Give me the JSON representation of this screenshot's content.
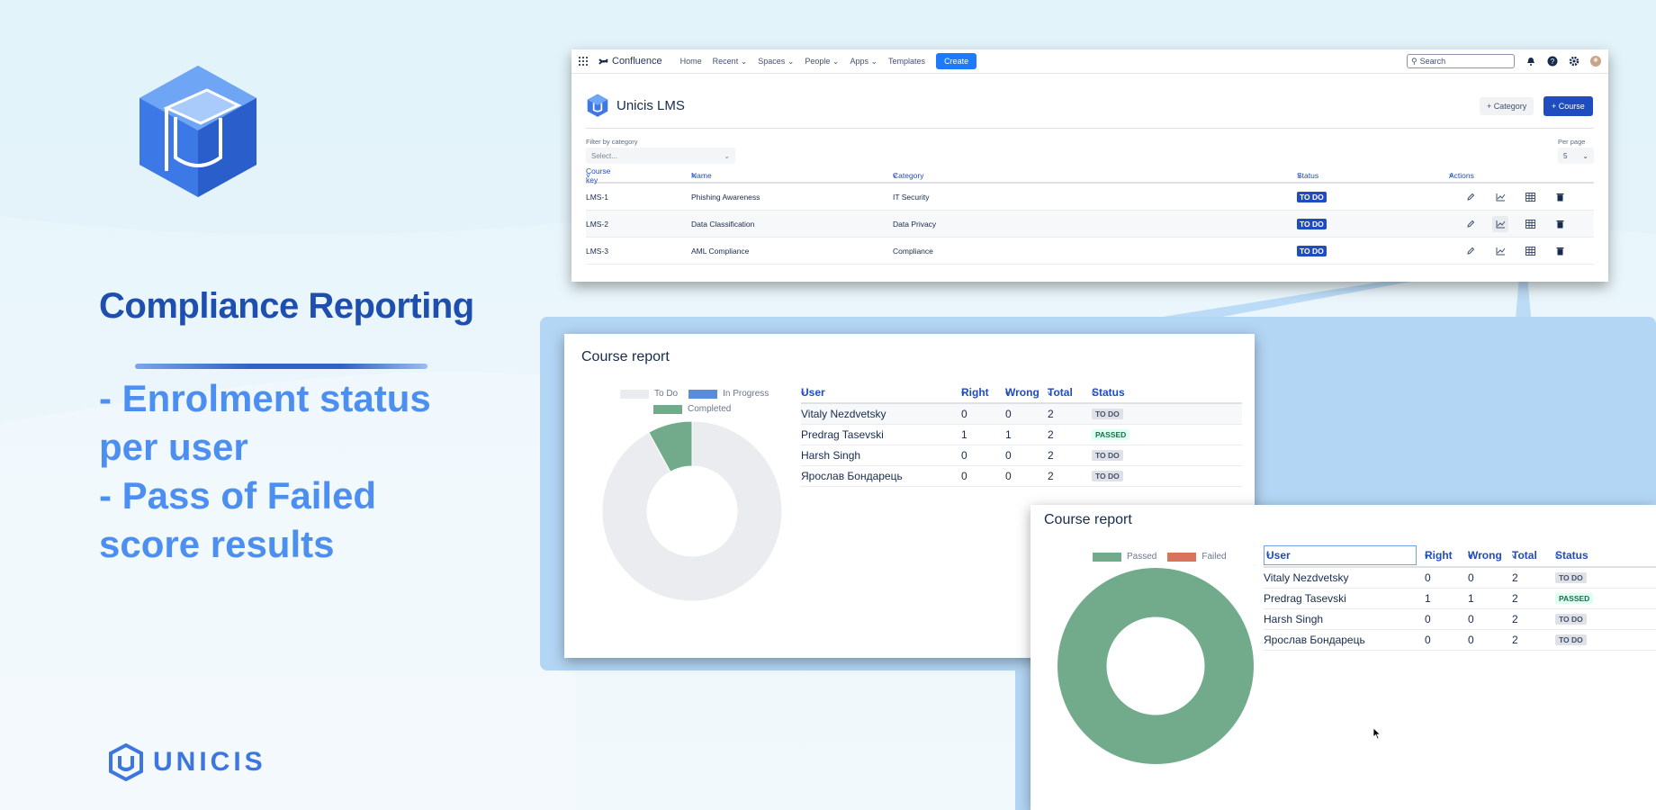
{
  "hero": {
    "title": "Compliance Reporting",
    "bullets": [
      "- Enrolment status",
      "per user",
      "- Pass of Failed",
      "score results"
    ],
    "brand": "UNICIS"
  },
  "colors": {
    "accent": "#1f4fae",
    "bullet": "#4c8ff0",
    "todo": "#1f4dbf",
    "passed_green": "#72ab8b",
    "failed_red": "#d9735b"
  },
  "confluence": {
    "brand": "Confluence",
    "nav": [
      "Home",
      "Recent",
      "Spaces",
      "People",
      "Apps",
      "Templates"
    ],
    "create_label": "Create",
    "search_placeholder": "Search",
    "app_title": "Unicis LMS",
    "add_category": "+ Category",
    "add_course": "+ Course",
    "filter_label": "Filter by category",
    "filter_placeholder": "Select...",
    "per_page_label": "Per page",
    "per_page_value": "5",
    "columns": [
      "Course key",
      "Name",
      "Category",
      "Status",
      "Actions"
    ],
    "rows": [
      {
        "key": "LMS-1",
        "name": "Phishing Awareness",
        "category": "IT Security",
        "status": "TO DO"
      },
      {
        "key": "LMS-2",
        "name": "Data Classification",
        "category": "Data Privacy",
        "status": "TO DO"
      },
      {
        "key": "LMS-3",
        "name": "AML Compliance",
        "category": "Compliance",
        "status": "TO DO"
      }
    ]
  },
  "report1": {
    "title": "Course report",
    "legend": [
      "To Do",
      "In Progress",
      "Completed"
    ],
    "columns": [
      "User",
      "Right",
      "Wrong",
      "Total",
      "Status"
    ],
    "rows": [
      {
        "user": "Vitaly Nezdvetsky",
        "right": "0",
        "wrong": "0",
        "total": "2",
        "status": "TO DO"
      },
      {
        "user": "Predrag Tasevski",
        "right": "1",
        "wrong": "1",
        "total": "2",
        "status": "PASSED"
      },
      {
        "user": "Harsh Singh",
        "right": "0",
        "wrong": "0",
        "total": "2",
        "status": "TO DO"
      },
      {
        "user": "Ярослав Бондарець",
        "right": "0",
        "wrong": "0",
        "total": "2",
        "status": "TO DO"
      }
    ]
  },
  "report2": {
    "title": "Course report",
    "legend": [
      "Passed",
      "Failed"
    ],
    "columns": [
      "User",
      "Right",
      "Wrong",
      "Total",
      "Status"
    ],
    "rows": [
      {
        "user": "Vitaly Nezdvetsky",
        "right": "0",
        "wrong": "0",
        "total": "2",
        "status": "TO DO"
      },
      {
        "user": "Predrag Tasevski",
        "right": "1",
        "wrong": "1",
        "total": "2",
        "status": "PASSED"
      },
      {
        "user": "Harsh Singh",
        "right": "0",
        "wrong": "0",
        "total": "2",
        "status": "TO DO"
      },
      {
        "user": "Ярослав Бондарець",
        "right": "0",
        "wrong": "0",
        "total": "2",
        "status": "TO DO"
      }
    ]
  },
  "chart_data": [
    {
      "type": "pie",
      "categories": [
        "To Do",
        "In Progress",
        "Completed"
      ],
      "values": [
        92,
        0,
        8
      ],
      "donut": true,
      "legend": "top"
    },
    {
      "type": "pie",
      "categories": [
        "Passed",
        "Failed"
      ],
      "values": [
        100,
        0
      ],
      "donut": true,
      "legend": "top"
    }
  ]
}
